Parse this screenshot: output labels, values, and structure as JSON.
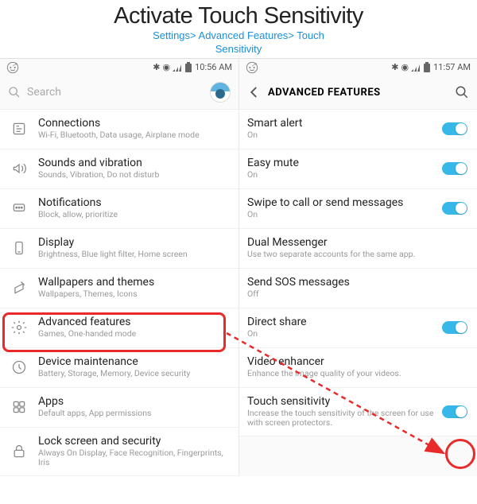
{
  "header": {
    "title": "Activate Touch Sensitivity",
    "breadcrumb_line1": "Settings> Advanced Features> Touch",
    "breadcrumb_line2": "Sensitivity"
  },
  "left": {
    "status": {
      "time": "10:56 AM"
    },
    "search_placeholder": "Search",
    "items": [
      {
        "label": "Connections",
        "sub": "Wi-Fi, Bluetooth, Data usage, Airplane mode"
      },
      {
        "label": "Sounds and vibration",
        "sub": "Sounds, Vibration, Do not disturb"
      },
      {
        "label": "Notifications",
        "sub": "Block, allow, prioritize"
      },
      {
        "label": "Display",
        "sub": "Brightness, Blue light filter, Home screen"
      },
      {
        "label": "Wallpapers and themes",
        "sub": "Wallpapers, Themes, Icons"
      },
      {
        "label": "Advanced features",
        "sub": "Games, One-handed mode"
      },
      {
        "label": "Device maintenance",
        "sub": "Battery, Storage, Memory, Device security"
      },
      {
        "label": "Apps",
        "sub": "Default apps, App permissions"
      },
      {
        "label": "Lock screen and security",
        "sub": "Always On Display, Face Recognition, Fingerprints, Iris"
      }
    ]
  },
  "right": {
    "status": {
      "time": "11:57 AM"
    },
    "page_title": "ADVANCED FEATURES",
    "items": [
      {
        "label": "Smart alert",
        "sub": "On",
        "toggle": "on"
      },
      {
        "label": "Easy mute",
        "sub": "On",
        "toggle": "on"
      },
      {
        "label": "Swipe to call or send messages",
        "sub": "On",
        "toggle": "on"
      },
      {
        "label": "Dual Messenger",
        "sub": "Use two separate accounts for the same app."
      },
      {
        "label": "Send SOS messages",
        "sub": "Off"
      },
      {
        "label": "Direct share",
        "sub": "On",
        "toggle": "on"
      },
      {
        "label": "Video enhancer",
        "sub": "Enhance the image quality of your videos."
      },
      {
        "label": "Touch sensitivity",
        "sub": "Increase the touch sensitivity of the screen for use with screen protectors.",
        "toggle": "on"
      }
    ]
  }
}
